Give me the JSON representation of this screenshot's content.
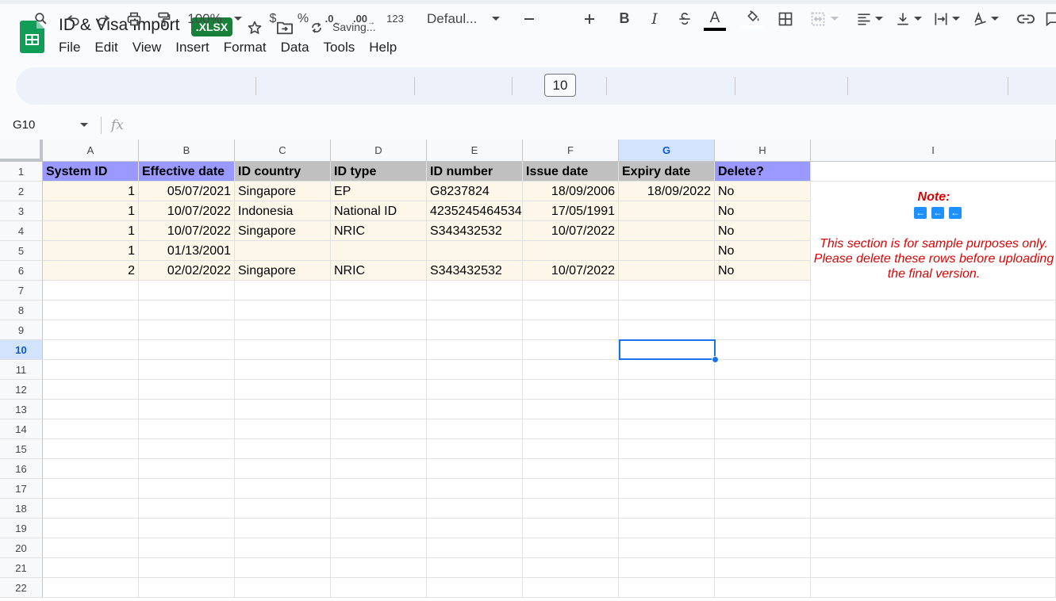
{
  "title_bar": {
    "doc_title": "ID & Visa Import",
    "file_badge": ".XLSX",
    "save_status": "Saving..."
  },
  "menu": [
    "File",
    "Edit",
    "View",
    "Insert",
    "Format",
    "Data",
    "Tools",
    "Help"
  ],
  "toolbar": {
    "zoom": "100%",
    "currency": "$",
    "percent": "%",
    "decrease_decimal": ".0",
    "increase_decimal": ".00",
    "number_format": "123",
    "font_name": "Defaul...",
    "font_size": "10",
    "bold": "B",
    "italic": "I",
    "text_color_letter": "A"
  },
  "formula_bar": {
    "name_box": "G10",
    "fx_label": "fx"
  },
  "sheet": {
    "columns": [
      "A",
      "B",
      "C",
      "D",
      "E",
      "F",
      "G",
      "H",
      "I"
    ],
    "selected_column": "G",
    "rows": [
      "1",
      "2",
      "3",
      "4",
      "5",
      "6",
      "7",
      "8",
      "9",
      "10",
      "11",
      "12",
      "13",
      "14",
      "15",
      "16",
      "17",
      "18",
      "19",
      "20",
      "21",
      "22"
    ],
    "selected_row": "10",
    "header_row": [
      "System ID",
      "Effective date",
      "ID country",
      "ID type",
      "ID number",
      "Issue date",
      "Expiry date",
      "Delete?"
    ],
    "data_rows": [
      [
        "1",
        "05/07/2021",
        "Singapore",
        "EP",
        "G8237824",
        "18/09/2006",
        "18/09/2022",
        "No"
      ],
      [
        "1",
        "10/07/2022",
        "Indonesia",
        "National ID",
        "4235245464534",
        "17/05/1991",
        "",
        "No"
      ],
      [
        "1",
        "10/07/2022",
        "Singapore",
        "NRIC",
        "S343432532",
        "10/07/2022",
        "",
        "No"
      ],
      [
        "1",
        "01/13/2001",
        "",
        "",
        "",
        "",
        "",
        "No"
      ],
      [
        "2",
        "02/02/2022",
        "Singapore",
        "NRIC",
        "S343432532",
        "10/07/2022",
        "",
        "No"
      ]
    ],
    "note": {
      "title": "Note:",
      "text_line1": "This section is for sample purposes only.",
      "text_line2": "Please delete these rows before uploading",
      "text_line3": "the final version."
    }
  },
  "colors": {
    "header_blue": "#9999ff",
    "header_gray": "#c0c0c0",
    "data_fill": "#fdf7ea",
    "note_red": "#e00000",
    "badge_green": "#188038",
    "selection_blue": "#1a73e8"
  }
}
